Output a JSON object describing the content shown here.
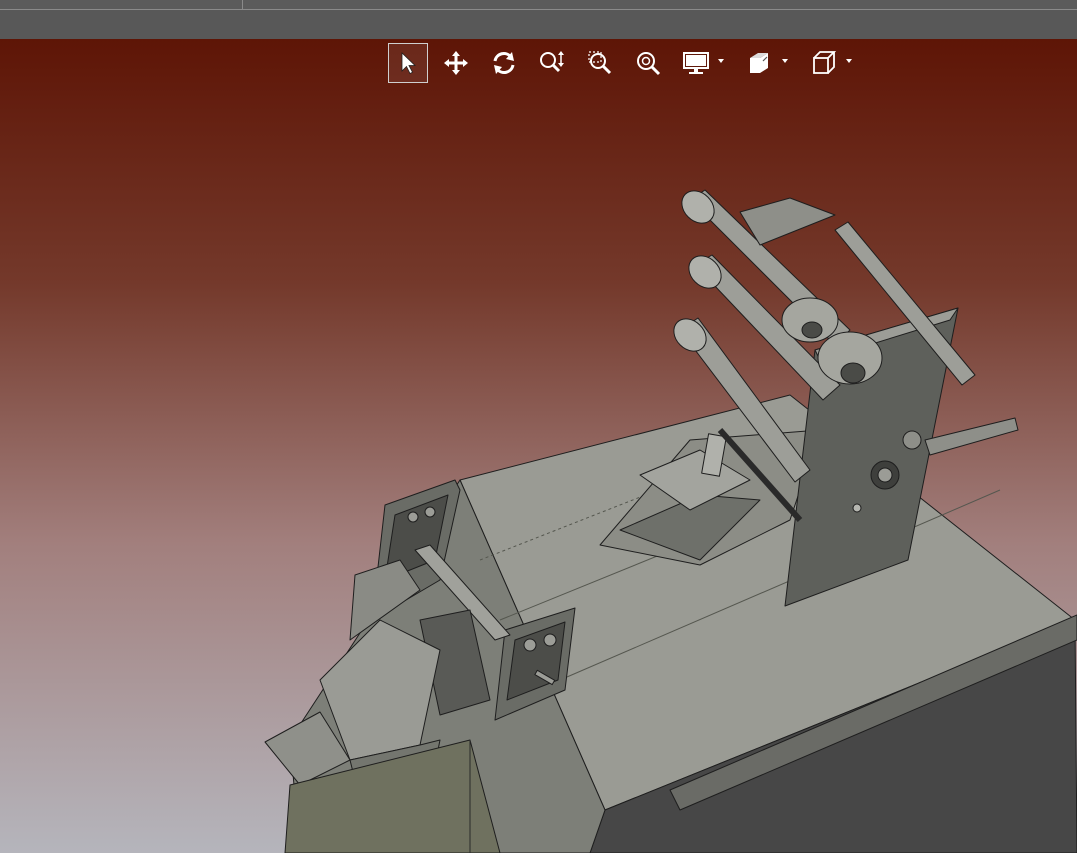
{
  "window": {
    "tabs": [
      {
        "label": ""
      },
      {
        "label": ""
      }
    ]
  },
  "toolbar": {
    "buttons": [
      {
        "name": "select",
        "icon": "cursor-arrow-icon",
        "active": true
      },
      {
        "name": "pan",
        "icon": "move-arrows-icon",
        "active": false
      },
      {
        "name": "rotate",
        "icon": "rotate-icon",
        "active": false
      },
      {
        "name": "zoom",
        "icon": "zoom-updown-icon",
        "active": false
      },
      {
        "name": "zoom-window",
        "icon": "zoom-window-icon",
        "active": false
      },
      {
        "name": "zoom-fit",
        "icon": "zoom-fit-icon",
        "active": false
      },
      {
        "name": "display-mode",
        "icon": "monitor-icon",
        "dropdown": true
      },
      {
        "name": "view-orientation",
        "icon": "view-cube-icon",
        "dropdown": true
      },
      {
        "name": "projection",
        "icon": "wire-box-icon",
        "dropdown": true
      }
    ]
  },
  "viewport": {
    "background_top": "#5e1506",
    "background_bottom": "#b5b5bc",
    "model_color": "#8e908a",
    "model_edge_color": "#1e1e1e"
  }
}
